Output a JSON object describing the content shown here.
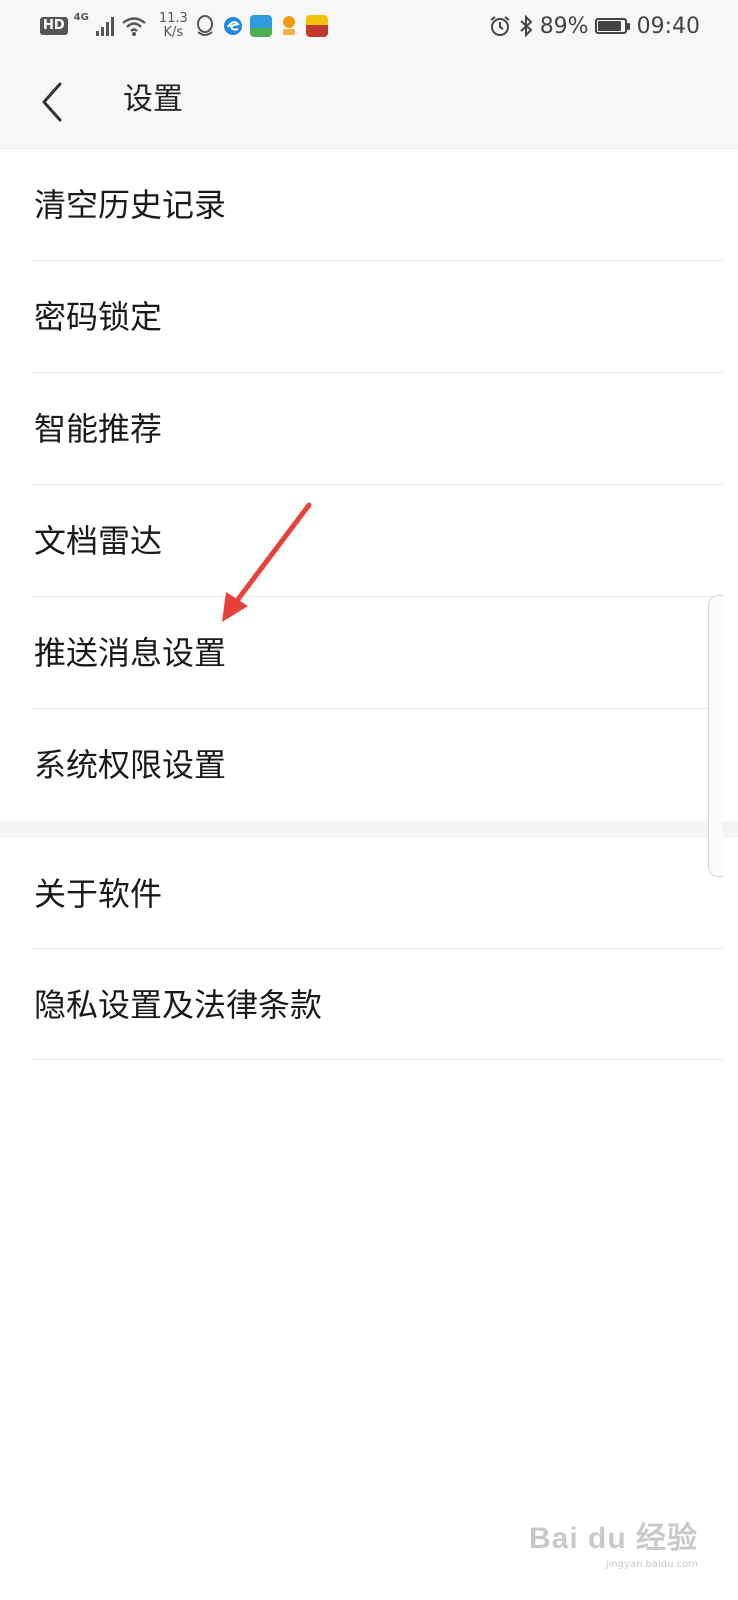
{
  "status_bar": {
    "hd_label": "HD",
    "network_type": "4G",
    "speed_value": "11.3",
    "speed_unit": "K/s",
    "battery_text": "89%",
    "battery_level": 0.89,
    "time": "09:40"
  },
  "header": {
    "title": "设置"
  },
  "settings": {
    "group1": [
      {
        "label": "清空历史记录"
      },
      {
        "label": "密码锁定"
      },
      {
        "label": "智能推荐"
      },
      {
        "label": "文档雷达"
      },
      {
        "label": "推送消息设置"
      },
      {
        "label": "系统权限设置"
      }
    ],
    "group2": [
      {
        "label": "关于软件"
      },
      {
        "label": "隐私设置及法律条款"
      }
    ]
  },
  "watermark": {
    "logo": "Bai du 经验",
    "url": "jingyan.baidu.com"
  },
  "colors": {
    "annotation_arrow": "#e8403a",
    "header_bg": "#f7f7f7",
    "divider": "#e6e6e6"
  }
}
